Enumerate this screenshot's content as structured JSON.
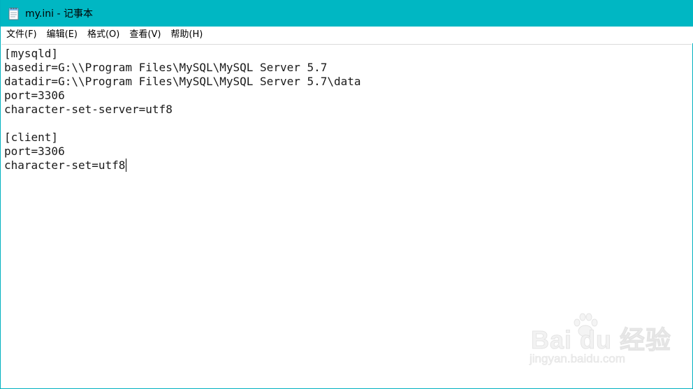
{
  "window": {
    "title": "my.ini - 记事本",
    "app_icon": "notepad-icon",
    "titlebar_color": "#00b7c3"
  },
  "menu": {
    "items": [
      {
        "label": "文件(F)"
      },
      {
        "label": "编辑(E)"
      },
      {
        "label": "格式(O)"
      },
      {
        "label": "查看(V)"
      },
      {
        "label": "帮助(H)"
      }
    ]
  },
  "editor": {
    "lines": [
      "[mysqld]",
      "basedir=G:\\\\Program Files\\MySQL\\MySQL Server 5.7",
      "datadir=G:\\\\Program Files\\MySQL\\MySQL Server 5.7\\data",
      "port=3306",
      "character-set-server=utf8",
      "",
      "[client]",
      "port=3306",
      "character-set=utf8"
    ]
  },
  "watermark": {
    "brand": "Bai du 经验",
    "sub": "jingyan.baidu.com"
  }
}
